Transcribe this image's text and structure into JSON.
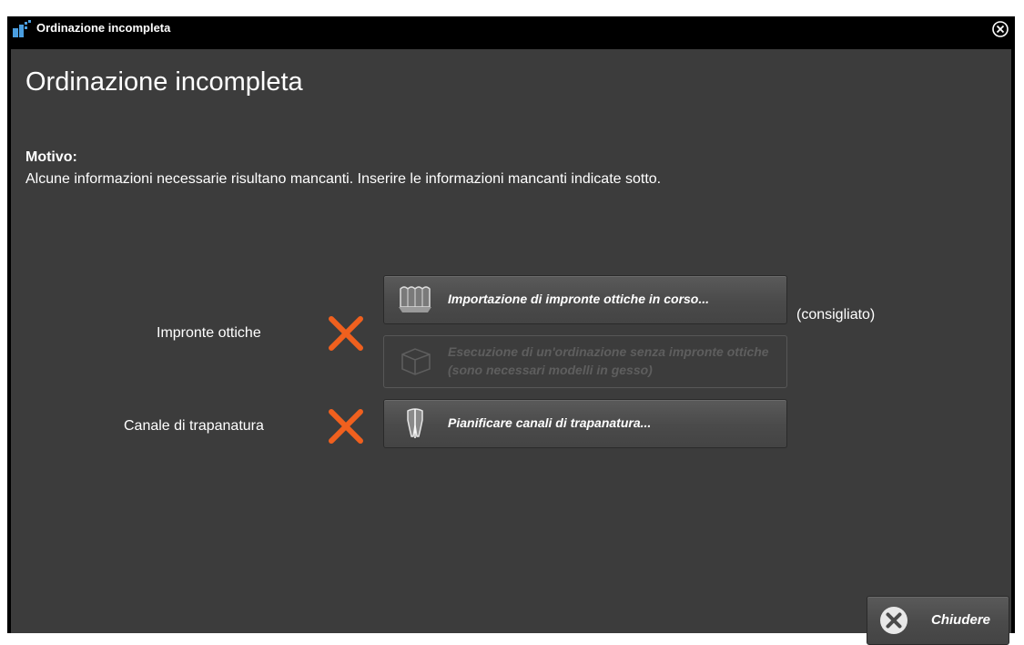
{
  "window": {
    "title": "Ordinazione incompleta",
    "close_icon": "close-circle-icon"
  },
  "main": {
    "heading": "Ordinazione incompleta",
    "reason_label": "Motivo:",
    "reason_text": "Alcune informazioni necessarie risultano mancanti. Inserire le informazioni mancanti indicate sotto."
  },
  "rows": [
    {
      "label": "Impronte ottiche",
      "status_icon": "x-mark-icon",
      "actions": [
        {
          "label": "Importazione di impronte ottiche in corso...",
          "icon": "optical-impressions-icon",
          "enabled": true,
          "note": "(consigliato)"
        },
        {
          "label": "Esecuzione di un'ordinazione senza impronte ottiche (sono necessari modelli in gesso)",
          "icon": "plaster-model-icon",
          "enabled": false
        }
      ]
    },
    {
      "label": "Canale di trapanatura",
      "status_icon": "x-mark-icon",
      "actions": [
        {
          "label": "Pianificare canali di trapanatura...",
          "icon": "drill-tooth-icon",
          "enabled": true
        }
      ]
    }
  ],
  "footer": {
    "close_label": "Chiudere",
    "close_icon": "close-circle-icon"
  },
  "colors": {
    "background": "#3c3c3c",
    "titlebar": "#000000",
    "x_mark": "#f0601e",
    "text": "#ffffff",
    "disabled_text": "#5e5e5e"
  }
}
